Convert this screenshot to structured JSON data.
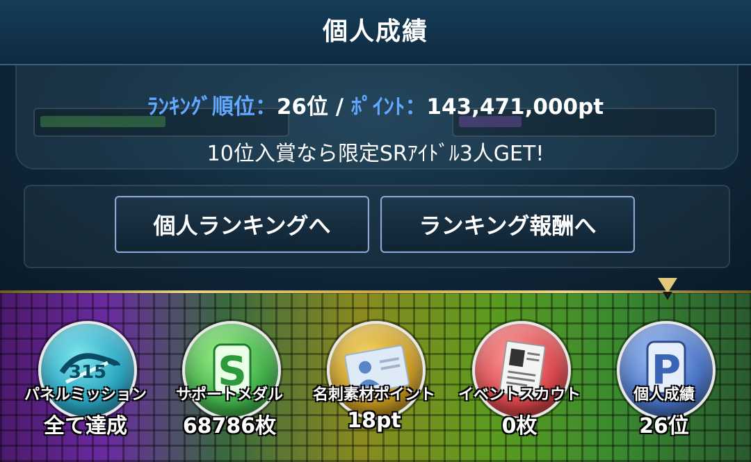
{
  "dialog": {
    "title": "個人成績",
    "rank_label": "ﾗﾝｷﾝｸﾞ順位：",
    "rank_value": "26位",
    "separator": " / ",
    "points_label": "ﾎﾟｲﾝﾄ：",
    "points_value": "143,471,000pt",
    "prize_text": "10位入賞なら限定SRｱｲﾄﾞﾙ3人GET!",
    "buttons": {
      "personal_ranking": "個人ランキングへ",
      "ranking_rewards": "ランキング報酬へ"
    }
  },
  "tabs": [
    {
      "name": "パネルミッション",
      "value": "全て達成",
      "icon": "panel-mission-medal-icon"
    },
    {
      "name": "サポートメダル",
      "value": "68786枚",
      "icon": "support-medal-icon"
    },
    {
      "name": "名刺素材ポイント",
      "value": "18pt",
      "icon": "business-card-icon"
    },
    {
      "name": "イベントスカウト",
      "value": "0枚",
      "icon": "event-scout-icon"
    },
    {
      "name": "個人成績",
      "value": "26位",
      "icon": "personal-results-icon"
    }
  ],
  "active_tab": "個人成績",
  "colors": {
    "label_blue": "#62a8ff",
    "button_border": "#8aa8d8",
    "gold": "#e2c878"
  }
}
